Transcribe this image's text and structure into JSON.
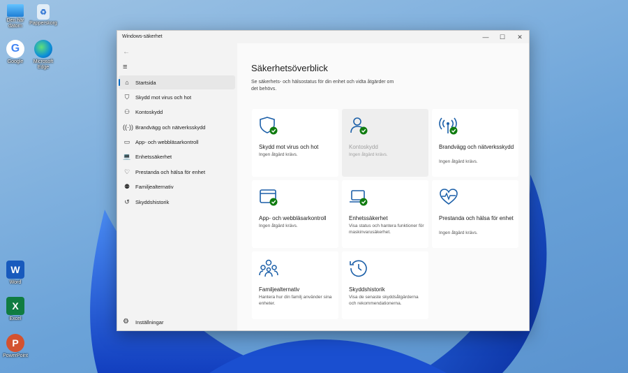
{
  "desktop": {
    "icons": [
      {
        "label": "Den här datorn",
        "icon": "computer-icon"
      },
      {
        "label": "Papperskorg",
        "icon": "recycle-bin-icon"
      },
      {
        "label": "Google",
        "icon": "google-icon"
      },
      {
        "label": "Microsoft Edge",
        "icon": "edge-icon"
      },
      {
        "label": "Word",
        "icon": "word-icon"
      },
      {
        "label": "Excel",
        "icon": "excel-icon"
      },
      {
        "label": "PowerPoint",
        "icon": "powerpoint-icon"
      }
    ]
  },
  "window": {
    "title": "Windows-säkerhet",
    "controls": [
      "—",
      "☐",
      "✕"
    ]
  },
  "sidebar": {
    "items": [
      {
        "label": "Startsida",
        "icon": "home-icon",
        "active": true
      },
      {
        "label": "Skydd mot virus och hot",
        "icon": "shield-icon"
      },
      {
        "label": "Kontoskydd",
        "icon": "person-icon"
      },
      {
        "label": "Brandvägg och nätverksskydd",
        "icon": "wifi-antenna-icon"
      },
      {
        "label": "App- och webbläsarkontroll",
        "icon": "app-window-icon"
      },
      {
        "label": "Enhetssäkerhet",
        "icon": "laptop-icon"
      },
      {
        "label": "Prestanda och hälsa för enhet",
        "icon": "heart-icon"
      },
      {
        "label": "Familjealternativ",
        "icon": "family-icon"
      },
      {
        "label": "Skyddshistorik",
        "icon": "history-icon"
      }
    ],
    "settings_label": "Inställningar"
  },
  "main": {
    "title": "Säkerhetsöverblick",
    "subtitle": "Se säkerhets- och hälsostatus för din enhet och vidta åtgärder om det behövs.",
    "cards": [
      {
        "title": "Skydd mot virus och hot",
        "status": "Ingen åtgärd krävs.",
        "icon": "shield-check-icon"
      },
      {
        "title": "Kontoskydd",
        "status": "Ingen åtgärd krävs.",
        "icon": "person-check-icon"
      },
      {
        "title": "Brandvägg och nätverksskydd",
        "status": "Ingen åtgärd krävs.",
        "icon": "antenna-check-icon"
      },
      {
        "title": "App- och webbläsarkontroll",
        "status": "Ingen åtgärd krävs.",
        "icon": "app-check-icon"
      },
      {
        "title": "Enhetssäkerhet",
        "status": "Visa status och hantera funktioner för maskinvarusäkerhet.",
        "icon": "laptop-check-icon"
      },
      {
        "title": "Prestanda och hälsa för enhet",
        "status": "Ingen åtgärd krävs.",
        "icon": "heartbeat-icon"
      },
      {
        "title": "Familjealternativ",
        "status": "Hantera hur din familj använder sina enheter.",
        "icon": "family-icon"
      },
      {
        "title": "Skyddshistorik",
        "status": "Visa de senaste skyddsåtgärderna och rekommendationerna.",
        "icon": "history-icon"
      }
    ]
  },
  "colors": {
    "accent": "#0067c0",
    "ok_green": "#107c10"
  }
}
